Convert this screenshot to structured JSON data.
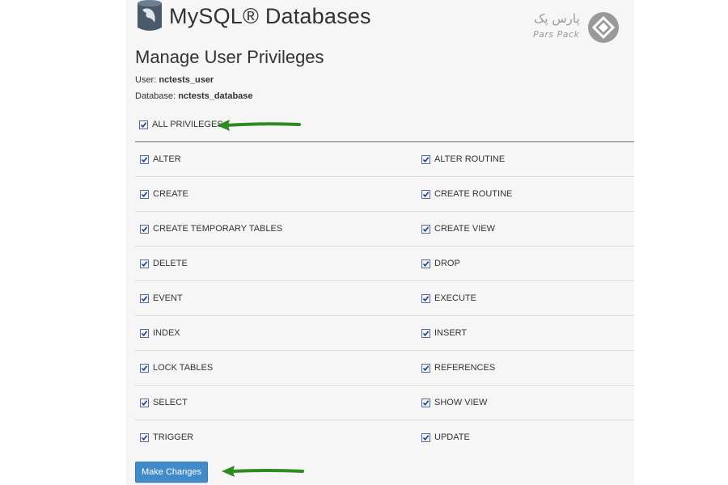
{
  "header": {
    "title": "MySQL® Databases",
    "icon": "database-dolphin-icon"
  },
  "brand": {
    "name_fa": "پارس پک",
    "name_en": "Pars Pack",
    "logo_icon": "parspack-logo-icon"
  },
  "page": {
    "title": "Manage User Privileges",
    "user_label": "User: ",
    "user_value": "nctests_user",
    "database_label": "Database: ",
    "database_value": "nctests_database"
  },
  "all_privileges": {
    "label": "ALL PRIVILEGES",
    "checked": true
  },
  "privileges": [
    {
      "left": {
        "label": "ALTER",
        "checked": true
      },
      "right": {
        "label": "ALTER ROUTINE",
        "checked": true
      }
    },
    {
      "left": {
        "label": "CREATE",
        "checked": true
      },
      "right": {
        "label": "CREATE ROUTINE",
        "checked": true
      }
    },
    {
      "left": {
        "label": "CREATE TEMPORARY TABLES",
        "checked": true
      },
      "right": {
        "label": "CREATE VIEW",
        "checked": true
      }
    },
    {
      "left": {
        "label": "DELETE",
        "checked": true
      },
      "right": {
        "label": "DROP",
        "checked": true
      }
    },
    {
      "left": {
        "label": "EVENT",
        "checked": true
      },
      "right": {
        "label": "EXECUTE",
        "checked": true
      }
    },
    {
      "left": {
        "label": "INDEX",
        "checked": true
      },
      "right": {
        "label": "INSERT",
        "checked": true
      }
    },
    {
      "left": {
        "label": "LOCK TABLES",
        "checked": true
      },
      "right": {
        "label": "REFERENCES",
        "checked": true
      }
    },
    {
      "left": {
        "label": "SELECT",
        "checked": true
      },
      "right": {
        "label": "SHOW VIEW",
        "checked": true
      }
    },
    {
      "left": {
        "label": "TRIGGER",
        "checked": true
      },
      "right": {
        "label": "UPDATE",
        "checked": true
      }
    }
  ],
  "actions": {
    "submit_label": "Make Changes"
  },
  "annotations": {
    "arrow_color": "#2e8b22",
    "arrow_icon": "green-arrow-icon"
  },
  "colors": {
    "button": "#428bca",
    "panel": "#f6f6f6",
    "checkbox_border": "#5a6e8c"
  }
}
